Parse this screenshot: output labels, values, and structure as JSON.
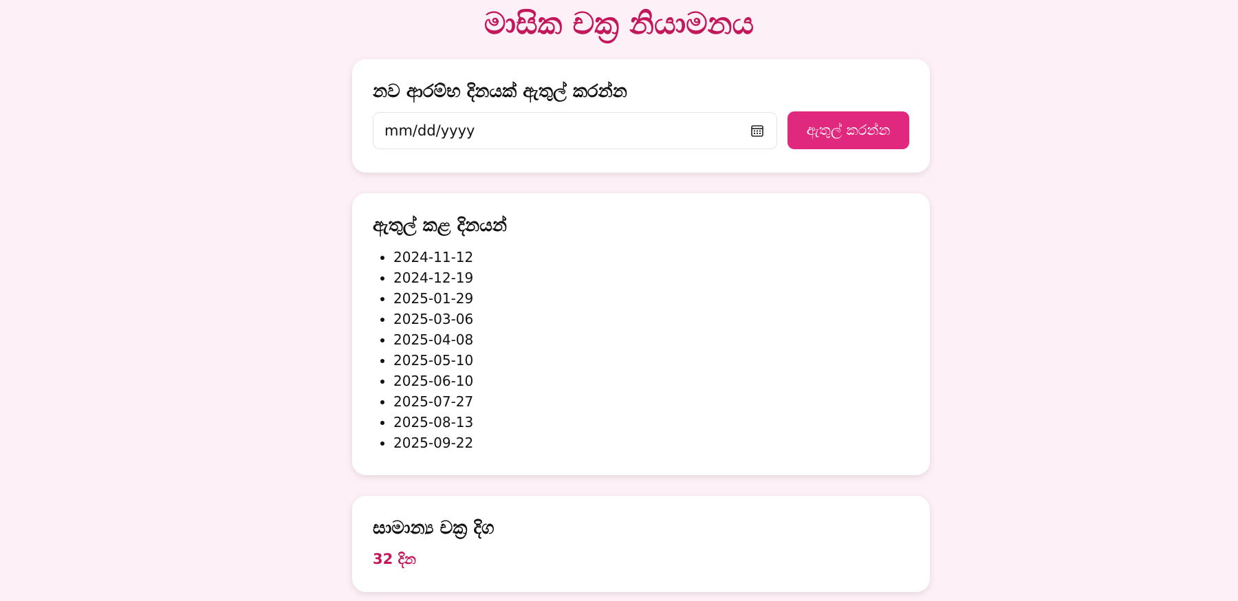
{
  "header": {
    "title": "මාසික චක්‍ර නියාමනය"
  },
  "add_section": {
    "title": "නව ආරම්භ දිනයක් ඇතුල් කරන්න",
    "date_placeholder": "mm/dd/yyyy",
    "calendar_icon": "calendar-icon",
    "button_label": "ඇතුල් කරන්න",
    "accent_color": "#e0297e"
  },
  "list_section": {
    "title": "ඇතුල් කළ දිනයන්",
    "dates": [
      "2024-11-12",
      "2024-12-19",
      "2025-01-29",
      "2025-03-06",
      "2025-04-08",
      "2025-05-10",
      "2025-06-10",
      "2025-07-27",
      "2025-08-13",
      "2025-09-22"
    ]
  },
  "average_section": {
    "title": "සාමාන්‍ය චක්‍ර දිග",
    "value": "32 දින",
    "value_color": "#c2185b"
  }
}
